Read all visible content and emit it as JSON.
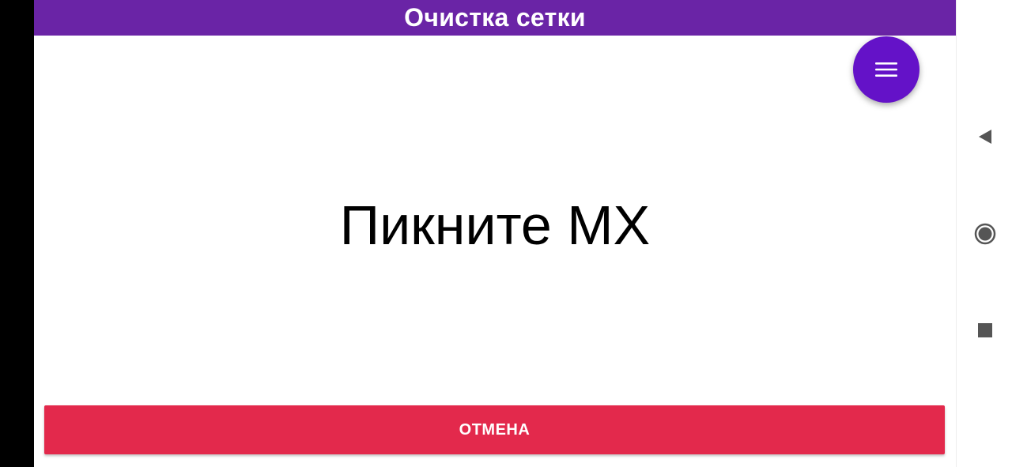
{
  "app_bar": {
    "title": "Очистка сетки",
    "color": "#6a24a6"
  },
  "fab": {
    "icon": "menu-icon",
    "color": "#6412c8"
  },
  "main": {
    "prompt_text": "Пикните MX"
  },
  "cancel_button": {
    "label": "ОТМЕНА",
    "color": "#e3294c"
  },
  "system_nav": {
    "back_icon": "back-triangle-icon",
    "home_icon": "home-circle-icon",
    "recents_icon": "recents-square-icon"
  }
}
